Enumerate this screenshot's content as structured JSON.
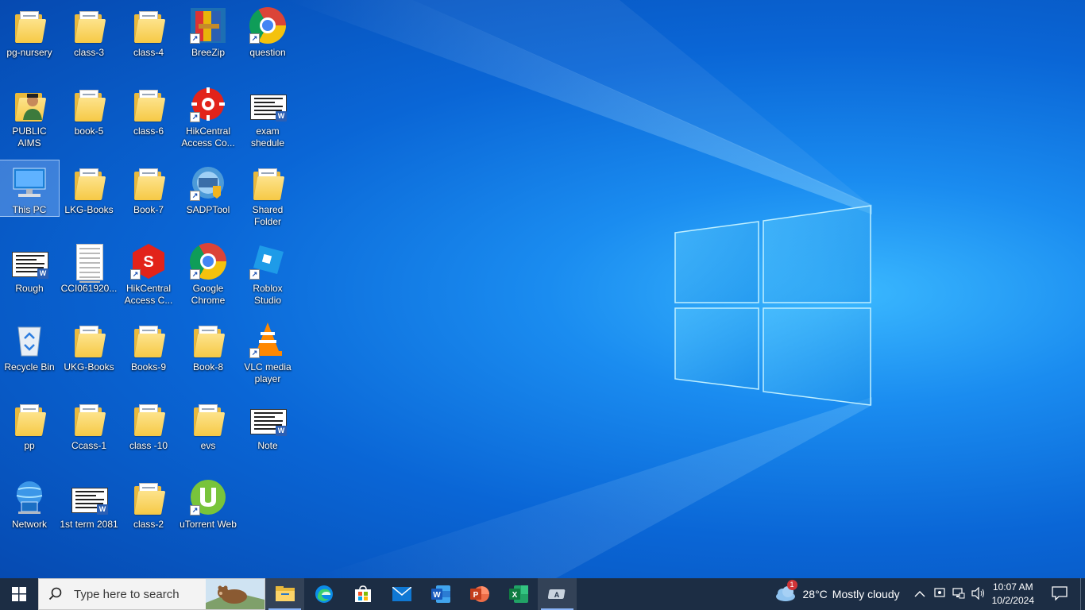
{
  "desktop": {
    "icons": [
      {
        "label": "pg-nursery",
        "kind": "folder"
      },
      {
        "label": "class-3",
        "kind": "folder"
      },
      {
        "label": "class-4",
        "kind": "folder"
      },
      {
        "label": "BreeZip",
        "kind": "breezip"
      },
      {
        "label": "question",
        "kind": "chrome"
      },
      {
        "label": "PUBLIC AIMS",
        "kind": "user-folder"
      },
      {
        "label": "book-5",
        "kind": "folder"
      },
      {
        "label": "class-6",
        "kind": "folder"
      },
      {
        "label": "HikCentral Access Co...",
        "kind": "hik-red"
      },
      {
        "label": "exam shedule",
        "kind": "word-doc"
      },
      {
        "label": "This PC",
        "kind": "this-pc"
      },
      {
        "label": "LKG-Books",
        "kind": "folder"
      },
      {
        "label": "Book-7",
        "kind": "folder"
      },
      {
        "label": "SADPTool",
        "kind": "sadp"
      },
      {
        "label": "Shared Folder",
        "kind": "folder"
      },
      {
        "label": "Rough",
        "kind": "word-doc"
      },
      {
        "label": "CCI061920...",
        "kind": "scan-doc"
      },
      {
        "label": "HikCentral Access C...",
        "kind": "hik-red2"
      },
      {
        "label": "Google Chrome",
        "kind": "chrome"
      },
      {
        "label": "Roblox Studio",
        "kind": "roblox"
      },
      {
        "label": "Recycle Bin",
        "kind": "recycle"
      },
      {
        "label": "UKG-Books",
        "kind": "folder"
      },
      {
        "label": "Books-9",
        "kind": "folder"
      },
      {
        "label": "Book-8",
        "kind": "folder"
      },
      {
        "label": "VLC media player",
        "kind": "vlc"
      },
      {
        "label": "pp",
        "kind": "folder"
      },
      {
        "label": "Ccass-1",
        "kind": "folder"
      },
      {
        "label": "class -10",
        "kind": "folder"
      },
      {
        "label": "evs",
        "kind": "folder"
      },
      {
        "label": "Note",
        "kind": "word-doc"
      },
      {
        "label": "Network",
        "kind": "network"
      },
      {
        "label": "1st term 2081",
        "kind": "word-doc"
      },
      {
        "label": "class-2",
        "kind": "folder"
      },
      {
        "label": "uTorrent Web",
        "kind": "utorrent"
      }
    ],
    "selected": "This PC"
  },
  "taskbar": {
    "search_placeholder": "Type here to search",
    "apps": [
      {
        "name": "File Explorer",
        "icon": "folder-icon"
      },
      {
        "name": "Microsoft Edge",
        "icon": "edge-icon"
      },
      {
        "name": "Microsoft Store",
        "icon": "store-icon"
      },
      {
        "name": "Mail",
        "icon": "mail-icon"
      },
      {
        "name": "Word",
        "icon": "word-icon"
      },
      {
        "name": "PowerPoint",
        "icon": "powerpoint-icon"
      },
      {
        "name": "Excel",
        "icon": "excel-icon"
      },
      {
        "name": "Typing app",
        "icon": "keyboard-icon"
      }
    ],
    "weather": {
      "temp": "28°C",
      "condition": "Mostly cloudy",
      "badge": "1"
    },
    "clock": {
      "time": "10:07 AM",
      "date": "10/2/2024"
    }
  }
}
